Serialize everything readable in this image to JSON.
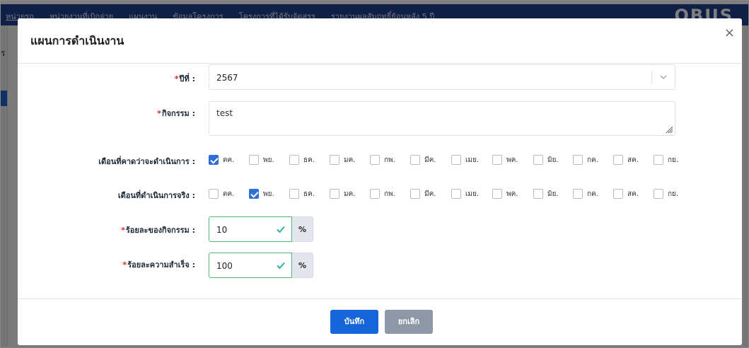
{
  "background": {
    "nav_items": [
      "หน่วยรถ",
      "หน่วยงานที่เบิกจ่าย",
      "แผนงาน",
      "ข้อมูลโครงการ",
      "โครงการที่ได้รับจัดสรร",
      "รายงานผลสัมฤทธิ์ย้อนหลัง 5 ปี"
    ],
    "logo_text": "OBUS",
    "left_letter": "ร"
  },
  "modal": {
    "title": "แผนการดำเนินงาน",
    "close_symbol": "×",
    "year": {
      "label": "ปีที่ :",
      "required_mark": "*",
      "value": "2567"
    },
    "activity": {
      "label": "กิจกรรม :",
      "required_mark": "*",
      "value": "test"
    },
    "planned_months": {
      "label": "เดือนที่คาดว่าจะดำเนินการ :",
      "items": [
        {
          "label": "ตค.",
          "checked": true
        },
        {
          "label": "พย.",
          "checked": false
        },
        {
          "label": "ธค.",
          "checked": false
        },
        {
          "label": "มค.",
          "checked": false
        },
        {
          "label": "กพ.",
          "checked": false
        },
        {
          "label": "มีค.",
          "checked": false
        },
        {
          "label": "เมย.",
          "checked": false
        },
        {
          "label": "พค.",
          "checked": false
        },
        {
          "label": "มิย.",
          "checked": false
        },
        {
          "label": "กค.",
          "checked": false
        },
        {
          "label": "สค.",
          "checked": false
        },
        {
          "label": "กย.",
          "checked": false
        }
      ]
    },
    "actual_months": {
      "label": "เดือนที่ดำเนินการจริง :",
      "items": [
        {
          "label": "ตค.",
          "checked": false
        },
        {
          "label": "พย.",
          "checked": true
        },
        {
          "label": "ธค.",
          "checked": false
        },
        {
          "label": "มค.",
          "checked": false
        },
        {
          "label": "กพ.",
          "checked": false
        },
        {
          "label": "มีค.",
          "checked": false
        },
        {
          "label": "เมย.",
          "checked": false
        },
        {
          "label": "พค.",
          "checked": false
        },
        {
          "label": "มิย.",
          "checked": false
        },
        {
          "label": "กค.",
          "checked": false
        },
        {
          "label": "สค.",
          "checked": false
        },
        {
          "label": "กย.",
          "checked": false
        }
      ]
    },
    "activity_percent": {
      "label": "ร้อยละของกิจกรรม :",
      "required_mark": "*",
      "value": "10",
      "unit": "%"
    },
    "success_percent": {
      "label": "ร้อยละความสำเร็จ :",
      "required_mark": "*",
      "value": "100",
      "unit": "%"
    },
    "buttons": {
      "save": "บันทึก",
      "cancel": "ยกเลิก"
    }
  },
  "colors": {
    "primary": "#1565d8",
    "cancel": "#8e97a6",
    "valid_border": "#57b877",
    "valid_check": "#2bb3a3",
    "required": "#e02424",
    "nav": "#1e3f8c"
  }
}
